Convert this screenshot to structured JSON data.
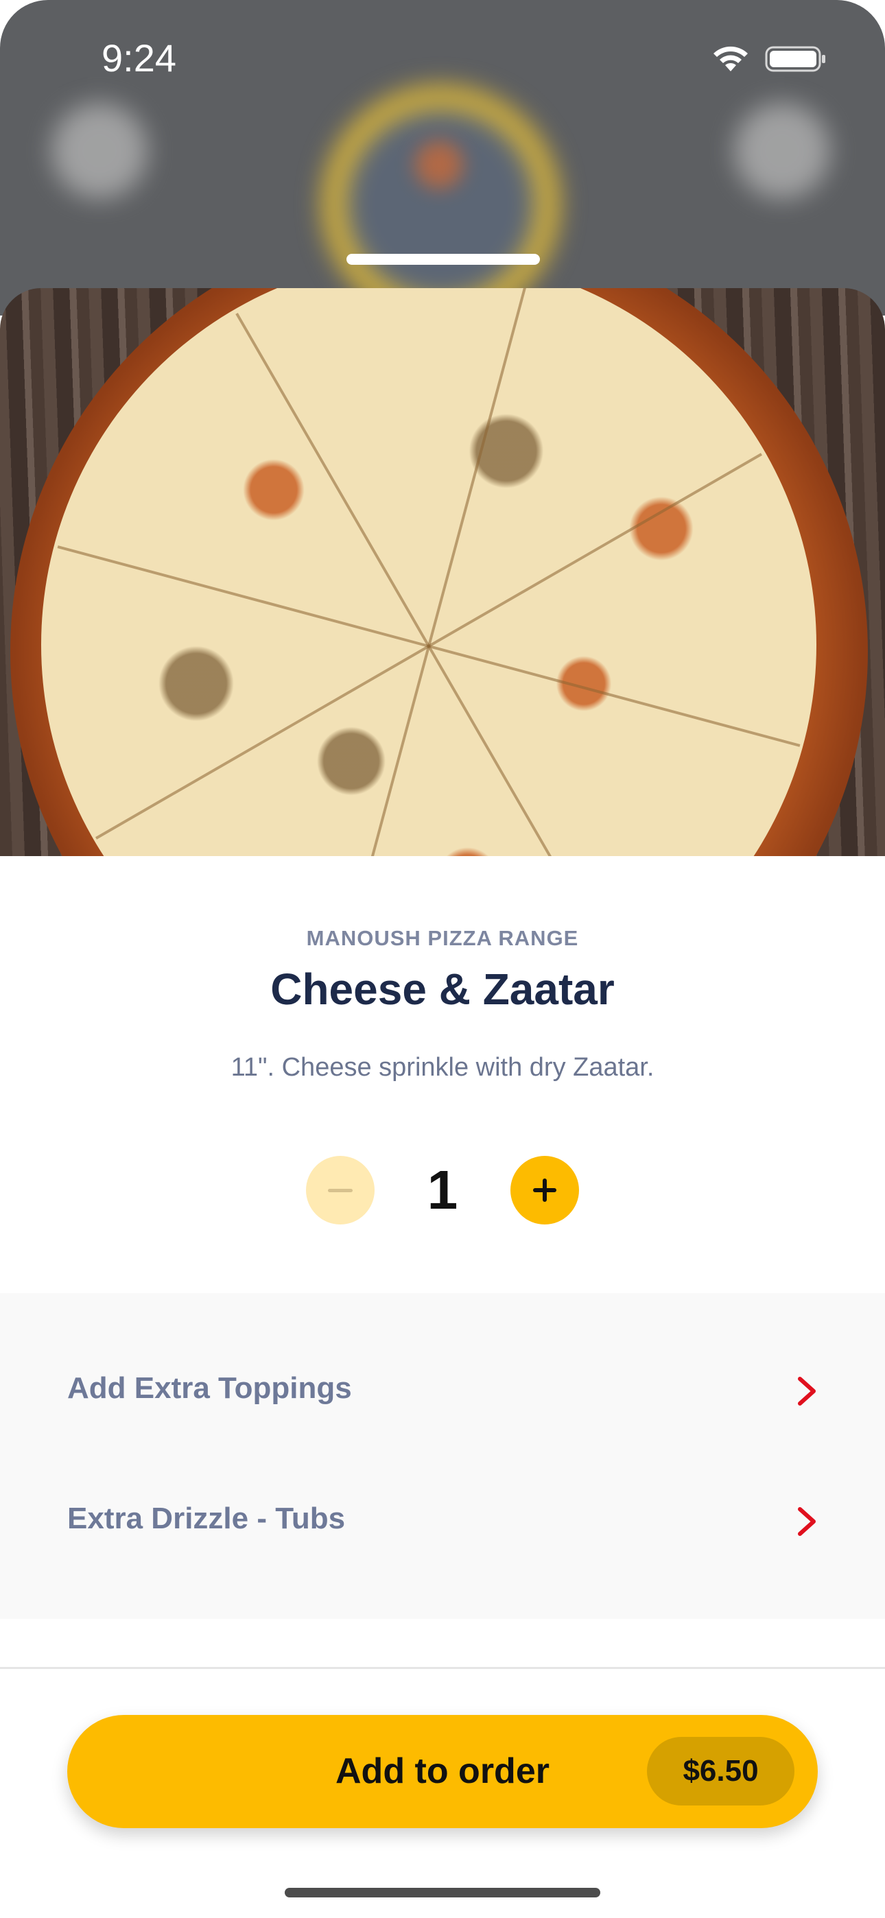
{
  "status_bar": {
    "time": "9:24"
  },
  "product": {
    "category": "MANOUSH PIZZA RANGE",
    "title": "Cheese & Zaatar",
    "description": "11\". Cheese sprinkle with dry Zaatar."
  },
  "quantity": {
    "value": "1"
  },
  "options": [
    {
      "label": "Add Extra Toppings",
      "icon": "chevron-right-icon"
    },
    {
      "label": "Extra Drizzle - Tubs",
      "icon": "chevron-right-icon"
    }
  ],
  "order_button": {
    "label": "Add to order",
    "price": "$6.50"
  },
  "colors": {
    "accent": "#FDBB00",
    "accent_light": "#FFEAB2",
    "chevron": "#E0101E",
    "title": "#1D2A4A",
    "muted": "#6E7998"
  }
}
